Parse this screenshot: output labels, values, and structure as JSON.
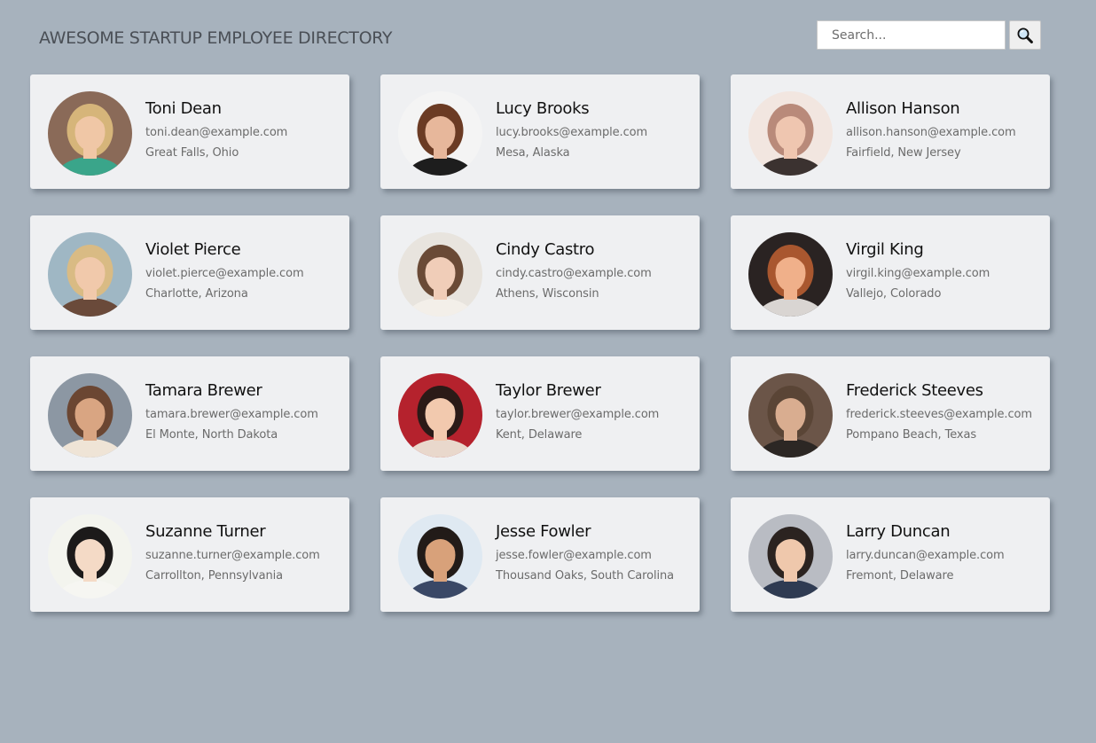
{
  "header": {
    "title": "AWESOME STARTUP EMPLOYEE DIRECTORY"
  },
  "search": {
    "placeholder": "Search...",
    "value": "",
    "button_icon": "search-icon"
  },
  "colors": {
    "background": "#a7b2bd",
    "card": "#eff0f2",
    "title": "#4a4f56",
    "name": "#111111",
    "detail": "#6b6b6b"
  },
  "employees": [
    {
      "name": "Toni Dean",
      "email": "toni.dean@example.com",
      "location": "Great Falls, Ohio",
      "avatar": {
        "bg": "#8a6a58",
        "skin": "#f0c7a6",
        "hair": "#d6b57a",
        "shirt": "#3aa58a"
      }
    },
    {
      "name": "Lucy Brooks",
      "email": "lucy.brooks@example.com",
      "location": "Mesa, Alaska",
      "avatar": {
        "bg": "#f4f4f4",
        "skin": "#e7b79b",
        "hair": "#6b3b24",
        "shirt": "#1d1d1d"
      }
    },
    {
      "name": "Allison Hanson",
      "email": "allison.hanson@example.com",
      "location": "Fairfield, New Jersey",
      "avatar": {
        "bg": "#f2e6e0",
        "skin": "#efc6b0",
        "hair": "#b98a7a",
        "shirt": "#3b3230"
      }
    },
    {
      "name": "Violet Pierce",
      "email": "violet.pierce@example.com",
      "location": "Charlotte, Arizona",
      "avatar": {
        "bg": "#9fb7c4",
        "skin": "#f1c9ab",
        "hair": "#d9bb84",
        "shirt": "#6a4a3a"
      }
    },
    {
      "name": "Cindy Castro",
      "email": "cindy.castro@example.com",
      "location": "Athens, Wisconsin",
      "avatar": {
        "bg": "#e8e4de",
        "skin": "#f0cdb8",
        "hair": "#6a4a36",
        "shirt": "#f3efe9"
      }
    },
    {
      "name": "Virgil King",
      "email": "virgil.king@example.com",
      "location": "Vallejo, Colorado",
      "avatar": {
        "bg": "#2a2322",
        "skin": "#f0b08a",
        "hair": "#a9572f",
        "shirt": "#d9d5d2"
      }
    },
    {
      "name": "Tamara Brewer",
      "email": "tamara.brewer@example.com",
      "location": "El Monte, North Dakota",
      "avatar": {
        "bg": "#8c97a3",
        "skin": "#d9a582",
        "hair": "#6b4632",
        "shirt": "#efe4d6"
      }
    },
    {
      "name": "Taylor Brewer",
      "email": "taylor.brewer@example.com",
      "location": "Kent, Delaware",
      "avatar": {
        "bg": "#b5222d",
        "skin": "#f2c9ae",
        "hair": "#2b1a17",
        "shirt": "#e9d8cc"
      }
    },
    {
      "name": "Frederick Steeves",
      "email": "frederick.steeves@example.com",
      "location": "Pompano Beach, Texas",
      "avatar": {
        "bg": "#6b5548",
        "skin": "#d9ad90",
        "hair": "#5a4536",
        "shirt": "#2c2724"
      }
    },
    {
      "name": "Suzanne Turner",
      "email": "suzanne.turner@example.com",
      "location": "Carrollton, Pennsylvania",
      "avatar": {
        "bg": "#f3f4ee",
        "skin": "#f4dac6",
        "hair": "#1c1a1a",
        "shirt": "#f6f6f2"
      }
    },
    {
      "name": "Jesse Fowler",
      "email": "jesse.fowler@example.com",
      "location": "Thousand Oaks, South Carolina",
      "avatar": {
        "bg": "#dfe9f2",
        "skin": "#d8a17a",
        "hair": "#221b18",
        "shirt": "#3a4866"
      }
    },
    {
      "name": "Larry Duncan",
      "email": "larry.duncan@example.com",
      "location": "Fremont, Delaware",
      "avatar": {
        "bg": "#b9bcc3",
        "skin": "#efc8ac",
        "hair": "#2b2320",
        "shirt": "#2f3b52"
      }
    }
  ]
}
